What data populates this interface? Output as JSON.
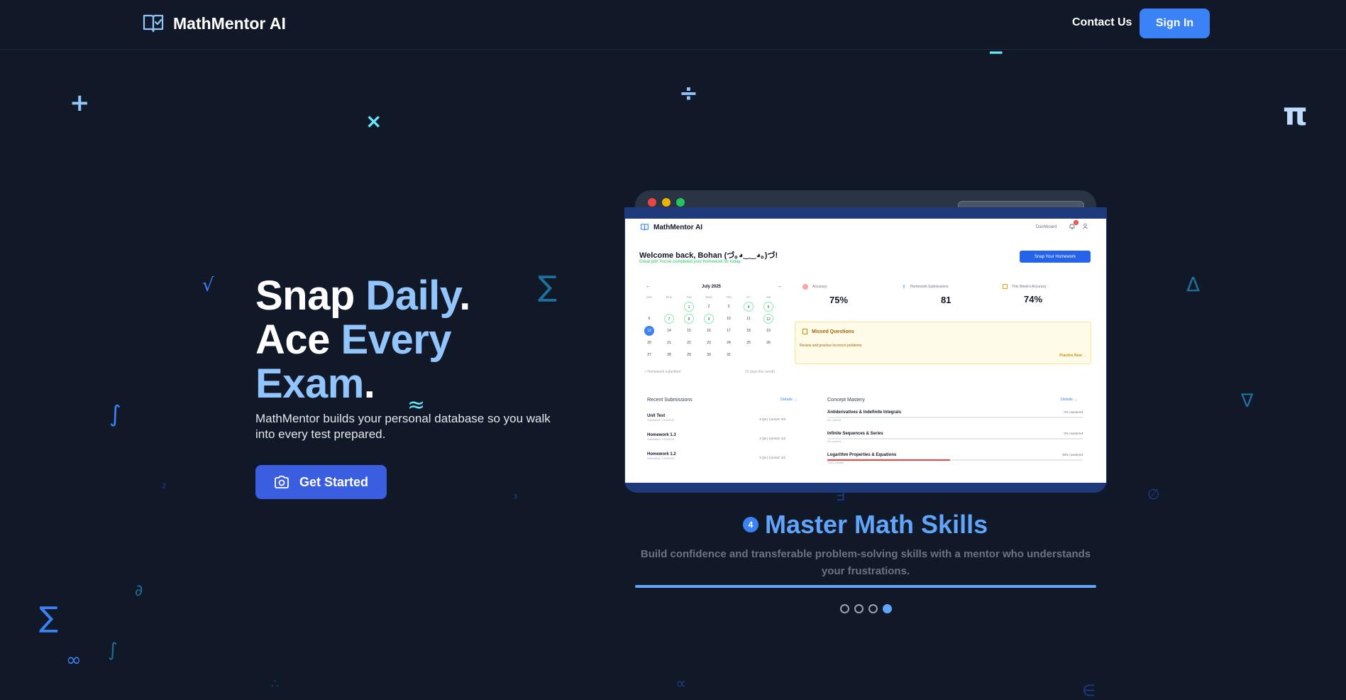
{
  "header": {
    "brand_name": "MathMentor AI",
    "contact_label": "Contact Us",
    "signin_label": "Sign In"
  },
  "hero": {
    "title_line1_a": "Snap ",
    "title_line1_b": "Daily",
    "title_line1_c": ".",
    "title_line2_a": "Ace ",
    "title_line2_b": "Every",
    "title_line3_b": "Exam",
    "title_line3_c": ".",
    "subtitle": "MathMentor builds your personal database so you walk into every test prepared.",
    "cta_label": "Get Started"
  },
  "math_symbols": [
    "+",
    "×",
    "÷",
    "−",
    "π",
    "√",
    "∑",
    "∫",
    "≈",
    "Δ",
    "∇",
    "²",
    "³",
    "∃",
    "∅",
    "∂",
    "∑",
    "∞",
    "∫",
    "∴",
    "∝",
    "∈"
  ],
  "mockup": {
    "brand": "MathMentor AI",
    "nav_dashboard": "Dashboard",
    "notification_count": "2",
    "welcome": "Welcome back, Bohan (づ｡◕‿‿◕｡)づ!",
    "welcome_sub": "Great job! You've completed your homework for today.",
    "snap_button": "Snap Your Homework",
    "calendar": {
      "month": "July 2025",
      "weekdays": [
        "Sun",
        "Mon",
        "Tue",
        "Wed",
        "Thu",
        "Fri",
        "Sat"
      ],
      "rows": [
        [
          "",
          "",
          "1",
          "2",
          "3",
          "4",
          "5"
        ],
        [
          "6",
          "7",
          "8",
          "9",
          "10",
          "11",
          "12"
        ],
        [
          "13",
          "14",
          "15",
          "16",
          "17",
          "18",
          "19"
        ],
        [
          "20",
          "21",
          "22",
          "23",
          "24",
          "25",
          "26"
        ],
        [
          "27",
          "28",
          "29",
          "30",
          "31",
          "",
          ""
        ]
      ],
      "legend": "Homework submitted",
      "days_count": "12 days this month"
    },
    "stats": [
      {
        "label": "Accuracy",
        "value": "75%"
      },
      {
        "label": "Homework Submissions",
        "value": "81"
      },
      {
        "label": "This Week's Accuracy",
        "value": "74%"
      }
    ],
    "missed": {
      "title": "Missed Questions",
      "desc": "Review and practice incorrect problems",
      "action": "Practice Now →"
    },
    "recent": {
      "title": "Recent Submissions",
      "details": "Details →",
      "items": [
        {
          "title": "Unit Test",
          "date": "Submitted: 7/13/2025",
          "score": "2 Qs | Correct: 2/2"
        },
        {
          "title": "Homework 1.3",
          "date": "Submitted: 7/13/2025",
          "score": "2 Qs | Correct: 1/2"
        },
        {
          "title": "Homework 1.2",
          "date": "Submitted: 7/13/2025",
          "score": "1 Qs | Correct: 1/1"
        }
      ]
    },
    "concepts": {
      "title": "Concept Mastery",
      "details": "Details →",
      "items": [
        {
          "title": "Antiderivatives & Indefinite Integrals",
          "mastery": "0% mastered",
          "sub": "0/1 correct",
          "level": 0
        },
        {
          "title": "Infinite Sequences & Series",
          "mastery": "0% mastered",
          "sub": "0/1 correct",
          "level": 0
        },
        {
          "title": "Logarithm Properties & Equations",
          "mastery": "48% mastered",
          "sub": "73/14 correct",
          "level": 0.48
        }
      ]
    }
  },
  "slide": {
    "step": "4",
    "title": "Master Math Skills",
    "description": "Build confidence and transferable problem-solving skills with a mentor who understands your frustrations.",
    "total": 4,
    "active": 4
  },
  "colors": {
    "background": "#111827",
    "accent": "#3b82f6",
    "highlight": "#93c5fd",
    "missed_bg": "#fefce8"
  }
}
